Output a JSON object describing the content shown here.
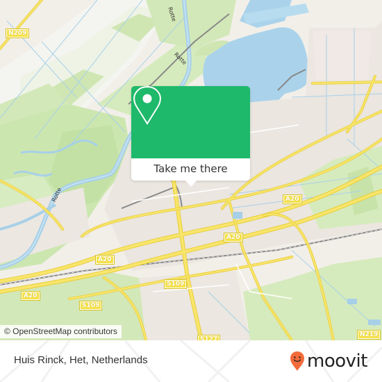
{
  "map": {
    "road_shields": [
      {
        "label": "N209",
        "id": "n209"
      },
      {
        "label": "A20",
        "id": "a20-center-right"
      },
      {
        "label": "A20",
        "id": "a20-center"
      },
      {
        "label": "A20",
        "id": "a20-left-upper"
      },
      {
        "label": "A20",
        "id": "a20-left-lower"
      },
      {
        "label": "S109",
        "id": "s109-center"
      },
      {
        "label": "S109",
        "id": "s109-left"
      },
      {
        "label": "S127",
        "id": "s127"
      },
      {
        "label": "N219",
        "id": "n219"
      }
    ],
    "river_labels": [
      "Rotte",
      "Rotte",
      "Rotte"
    ],
    "attribution": "© OpenStreetMap contributors"
  },
  "popup": {
    "icon": "location-pin-icon",
    "button_label": "Take me there",
    "color": "#1eb96a"
  },
  "footer": {
    "place_name": "Huis Rinck, Het, Netherlands",
    "brand": "moovit",
    "brand_color": "#f26b3a"
  }
}
